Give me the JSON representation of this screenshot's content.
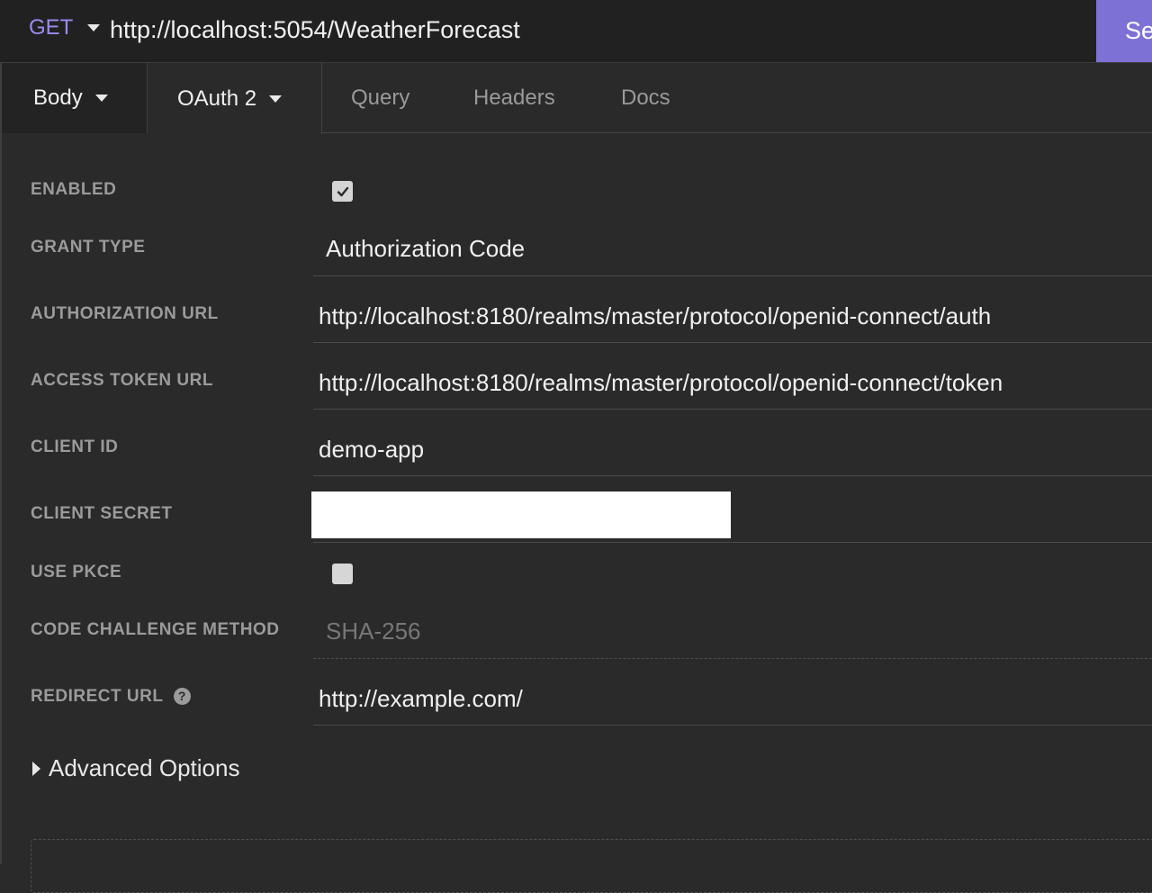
{
  "request": {
    "method": "GET",
    "url": "http://localhost:5054/WeatherForecast",
    "send_label": "Send"
  },
  "tabs": {
    "body": "Body",
    "auth": "OAuth 2",
    "query": "Query",
    "headers": "Headers",
    "docs": "Docs"
  },
  "form": {
    "enabled": {
      "label": "ENABLED",
      "checked": true
    },
    "grant_type": {
      "label": "GRANT TYPE",
      "value": "Authorization Code"
    },
    "authorization_url": {
      "label": "AUTHORIZATION URL",
      "value": "http://localhost:8180/realms/master/protocol/openid-connect/auth"
    },
    "access_token_url": {
      "label": "ACCESS TOKEN URL",
      "value": "http://localhost:8180/realms/master/protocol/openid-connect/token"
    },
    "client_id": {
      "label": "CLIENT ID",
      "value": "demo-app"
    },
    "client_secret": {
      "label": "CLIENT SECRET",
      "value": ""
    },
    "use_pkce": {
      "label": "USE PKCE",
      "checked": false
    },
    "code_challenge_method": {
      "label": "CODE CHALLENGE METHOD",
      "value": "SHA-256"
    },
    "redirect_url": {
      "label": "REDIRECT URL",
      "value": "http://example.com/",
      "help_icon": "?"
    },
    "advanced_options": "Advanced Options"
  },
  "colors": {
    "accent": "#7e71d6",
    "method": "#9a8cf0",
    "background": "#2a2a2a"
  }
}
